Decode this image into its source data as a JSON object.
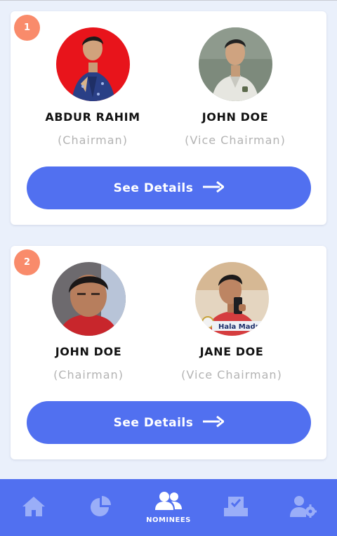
{
  "cards": [
    {
      "number": "1",
      "nominees": [
        {
          "name": "ABDUR RAHIM",
          "role": "(Chairman)"
        },
        {
          "name": "JOHN DOE",
          "role": "(Vice Chairman)"
        }
      ],
      "details_label": "See Details"
    },
    {
      "number": "2",
      "nominees": [
        {
          "name": "JOHN DOE",
          "role": "(Chairman)"
        },
        {
          "name": "JANE DOE",
          "role": "(Vice Chairman)"
        }
      ],
      "details_label": "See Details"
    }
  ],
  "avatar_caption": "Hala Madr",
  "nav": {
    "items": [
      {
        "icon": "home-icon",
        "label": ""
      },
      {
        "icon": "pie-chart-icon",
        "label": ""
      },
      {
        "icon": "users-icon",
        "label": "NOMINEES",
        "active": true
      },
      {
        "icon": "vote-box-icon",
        "label": ""
      },
      {
        "icon": "user-settings-icon",
        "label": ""
      }
    ]
  },
  "colors": {
    "accent": "#5170f0",
    "badge": "#f98b6b",
    "background": "#eaf0fb",
    "nav_icon_inactive": "#9aaef8",
    "nav_icon_active": "#ffffff"
  }
}
